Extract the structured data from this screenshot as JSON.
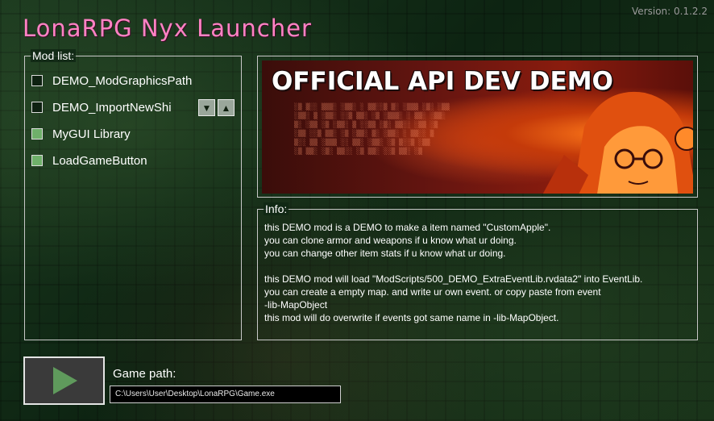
{
  "app": {
    "title": "LonaRPG Nyx Launcher",
    "version": "Version: 0.1.2.2"
  },
  "mod_list": {
    "legend": "Mod list:",
    "items": [
      {
        "label": "DEMO_ModGraphicsPath",
        "checked": false
      },
      {
        "label": "DEMO_ImportNewShi",
        "checked": false
      },
      {
        "label": "MyGUI Library",
        "checked": true
      },
      {
        "label": "LoadGameButton",
        "checked": true
      }
    ],
    "move_down_icon": "triangle-down-icon",
    "move_up_icon": "triangle-up-icon"
  },
  "banner": {
    "text": "OFFICIAL API DEV DEMO"
  },
  "info": {
    "legend": "Info:",
    "lines": [
      "this DEMO mod is a DEMO to make a item named \"CustomApple\".",
      "you can clone armor and weapons if u know what ur doing.",
      "you can change other item stats if u know what ur doing.",
      "",
      "this DEMO mod will load \"ModScripts/500_DEMO_ExtraEventLib.rvdata2\" into EventLib.",
      "you can create a empty map. and write ur own event. or copy paste from event",
      "-lib-MapObject",
      "this mod will do overwrite if events got same name in -lib-MapObject."
    ]
  },
  "launch": {
    "play_icon": "play-icon",
    "path_label": "Game path:",
    "path_value": "C:\\Users\\User\\Desktop\\LonaRPG\\Game.exe"
  },
  "colors": {
    "title": "#ff82c4",
    "checked": "#6fb06a",
    "play_arrow": "#5f9a5c"
  }
}
